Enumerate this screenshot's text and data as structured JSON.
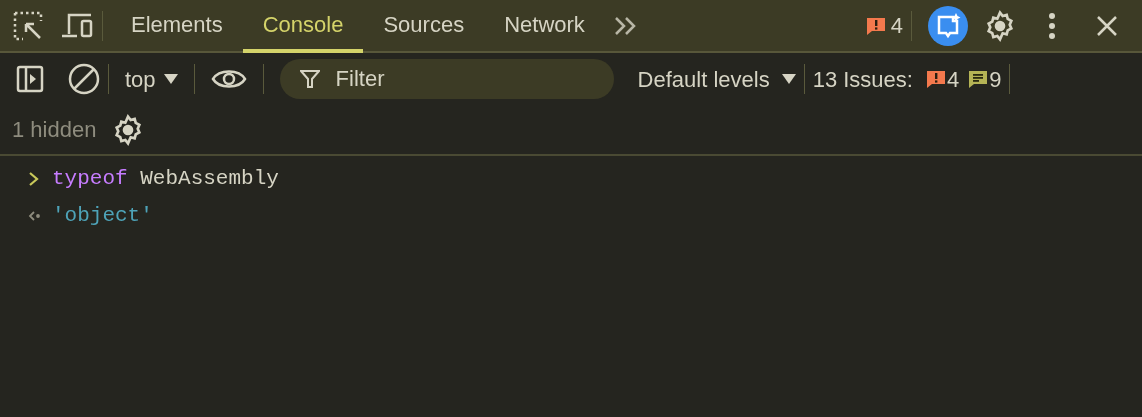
{
  "tabs": [
    {
      "label": "Elements",
      "selected": false
    },
    {
      "label": "Console",
      "selected": true
    },
    {
      "label": "Sources",
      "selected": false
    },
    {
      "label": "Network",
      "selected": false
    }
  ],
  "top_bar": {
    "error_count": "4"
  },
  "toolbar": {
    "context": "top",
    "filter": {
      "placeholder": "Filter"
    },
    "levels": "Default levels",
    "issues_label": "13 Issues:",
    "issue_errors": "4",
    "issue_infos": "9"
  },
  "hidden_row": {
    "label": "1 hidden"
  },
  "console": [
    {
      "kind": "input",
      "tokens": [
        {
          "kind": "keyword",
          "text": "typeof"
        },
        {
          "kind": "identifier",
          "text": "WebAssembly"
        }
      ]
    },
    {
      "kind": "output",
      "tokens": [
        {
          "kind": "string",
          "text": "'object'"
        }
      ]
    }
  ]
}
